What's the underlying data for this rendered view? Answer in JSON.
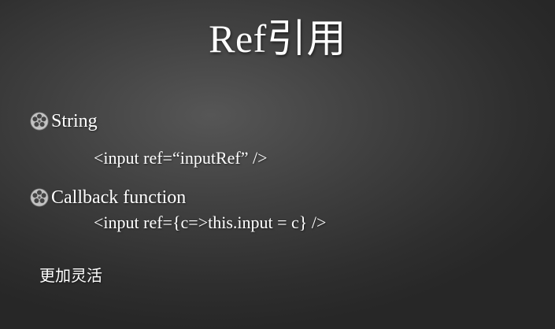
{
  "slide": {
    "title": "Ref引用",
    "bullets": [
      {
        "icon": "film-reel-icon",
        "label": "String",
        "code": "<input ref=“inputRef” />"
      },
      {
        "icon": "film-reel-icon",
        "label": "Callback function",
        "code": "<input ref={c=>this.input = c} />"
      }
    ],
    "note": "更加灵活"
  }
}
